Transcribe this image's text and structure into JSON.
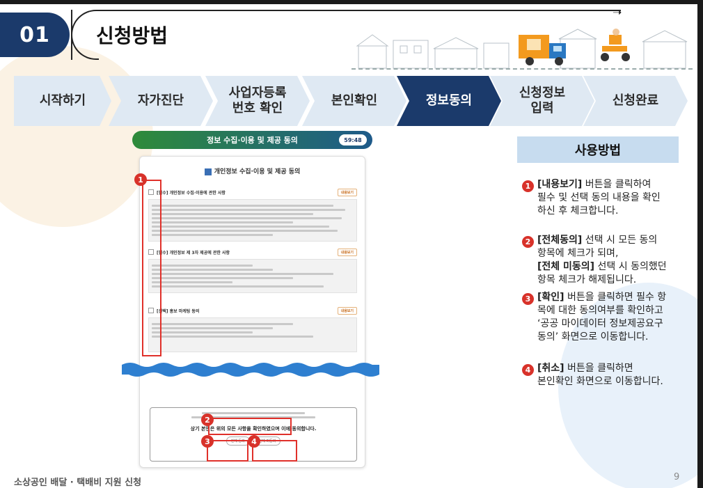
{
  "header": {
    "section_number": "01",
    "title": "신청방법"
  },
  "steps": [
    {
      "label": "시작하기",
      "active": false
    },
    {
      "label": "자가진단",
      "active": false
    },
    {
      "label": "사업자등록\n번호 확인",
      "active": false
    },
    {
      "label": "본인확인",
      "active": false
    },
    {
      "label": "정보동의",
      "active": true
    },
    {
      "label": "신청정보\n입력",
      "active": false
    },
    {
      "label": "신청완료",
      "active": false
    }
  ],
  "screen": {
    "header_title": "정보 수집·이용 및 제공 동의",
    "timer": "59:48",
    "doc_title": "개인정보 수집·이용 및 제공 동의",
    "sections": [
      {
        "title": "[필수] 개인정보 수집·이용에 관한 사항",
        "view": "내용보기"
      },
      {
        "title": "[필수] 개인정보 제 3자 제공에 관한 사항",
        "view": "내용보기"
      },
      {
        "title": "[선택] 홍보 마케팅 동의",
        "view": "내용보기"
      }
    ],
    "agree_question": "상기 본인은 위의 모든 사항을 확인하였으며 이에 동의합니다.",
    "agree_all": "전체 동의",
    "disagree_all": "전체 미동의",
    "ok_button": "확인",
    "cancel_button": "취소"
  },
  "markers": [
    "1",
    "2",
    "3",
    "4"
  ],
  "usage": {
    "title": "사용방법",
    "items": [
      {
        "num": "1",
        "bold": "[내용보기]",
        "rest": " 버튼을 클릭하여\n필수 및 선택 동의 내용을 확인\n하신 후 체크합니다."
      },
      {
        "num": "2",
        "bold": "[전체동의]",
        "rest": " 선택 시 모든 동의\n항목에 체크가 되며,\n",
        "bold2": "[전체 미동의]",
        "rest2": " 선택 시 동의했던\n항목 체크가 해제됩니다."
      },
      {
        "num": "3",
        "bold": "[확인]",
        "rest": " 버튼을 클릭하면 필수 항\n목에 대한 동의여부를 확인하고\n‘공공 마이데이터 정보제공요구\n동의’ 화면으로 이동합니다."
      },
      {
        "num": "4",
        "bold": "[취소]",
        "rest": " 버튼을 클릭하면\n본인확인 화면으로 이동합니다."
      }
    ]
  },
  "footer": {
    "text": "소상공인 배달 · 택배비 지원 신청",
    "page": "9"
  },
  "colors": {
    "navy": "#1b3a6b",
    "step_bg": "#dfe9f3",
    "usage_head": "#c7dcef",
    "marker_red": "#d8322a"
  }
}
